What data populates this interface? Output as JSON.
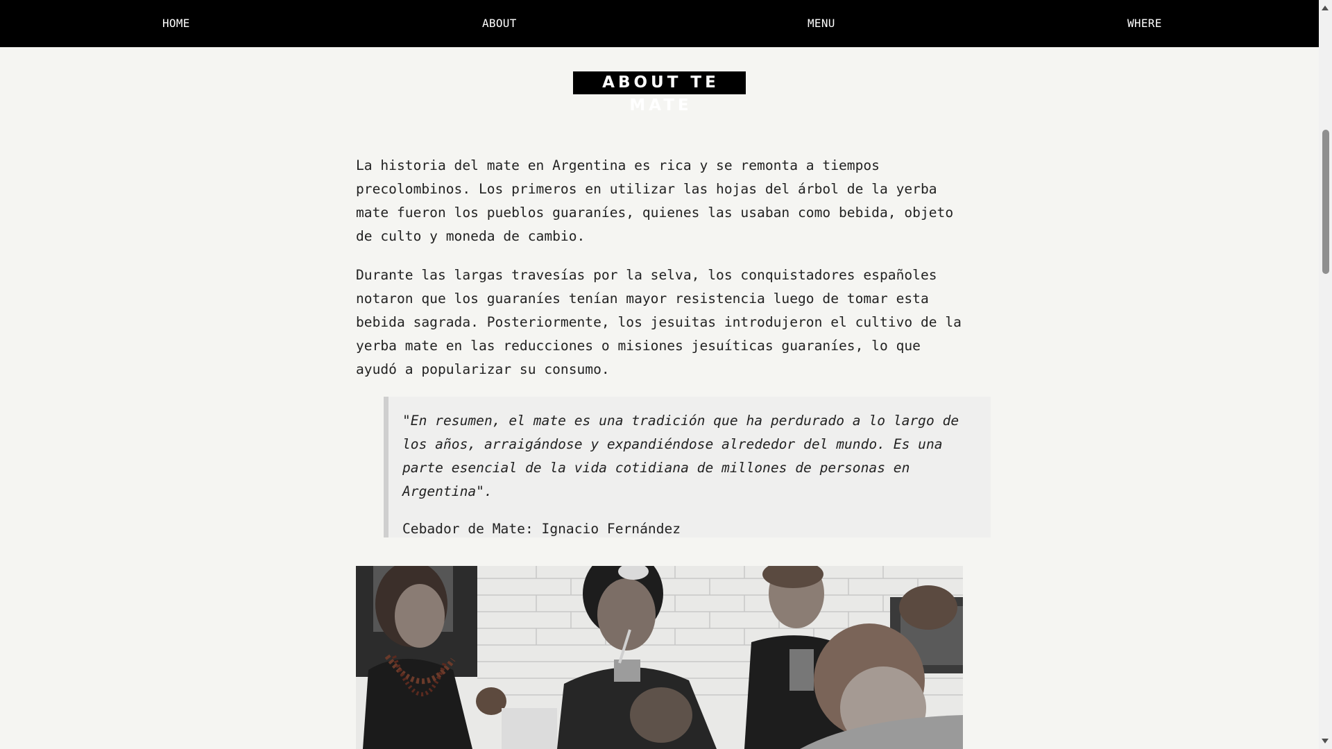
{
  "nav": {
    "items": [
      {
        "label": "HOME"
      },
      {
        "label": "ABOUT"
      },
      {
        "label": "MENU"
      },
      {
        "label": "WHERE"
      }
    ]
  },
  "page": {
    "title": "ABOUT TE MATE"
  },
  "content": {
    "paragraphs": [
      "La historia del mate en Argentina es rica y se remonta a tiempos precolombinos. Los primeros en utilizar las hojas del árbol de la yerba mate fueron los pueblos guaraníes, quienes las usaban como bebida, objeto de culto y moneda de cambio.",
      "Durante las largas travesías por la selva, los conquistadores españoles notaron que los guaraníes tenían mayor resistencia luego de tomar esta bebida sagrada. Posteriormente, los jesuitas introdujeron el cultivo de la yerba mate en las reducciones o misiones jesuíticas guaraníes, lo que ayudó a popularizar su consumo."
    ],
    "quote": {
      "text": "\"En resumen, el mate es una tradición que ha perdurado a lo largo de los años, arraigándose y expandiéndose alrededor del mundo. Es una parte esencial de la vida cotidiana de millones de personas en Argentina\".",
      "author": "Cebador de Mate: Ignacio Fernández"
    }
  },
  "colors": {
    "nav_background": "#000000",
    "nav_text": "#ffffff",
    "page_background": "#f5f5f2",
    "quote_background": "#efefee",
    "quote_border": "#cfcfcf"
  },
  "icons": {
    "scroll_up": "triangle-up-icon",
    "scroll_down": "triangle-down-icon"
  }
}
